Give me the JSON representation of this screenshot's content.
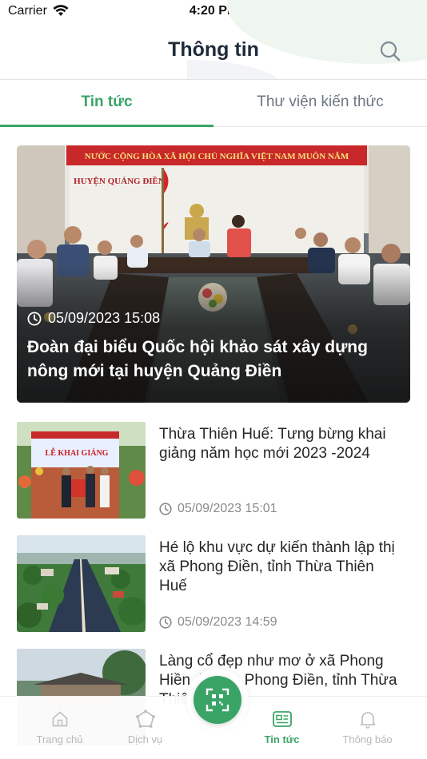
{
  "status_bar": {
    "carrier": "Carrier",
    "time": "4:20 PM"
  },
  "header": {
    "title": "Thông tin",
    "search_icon": "search-icon"
  },
  "tabs": [
    {
      "label": "Tin tức",
      "active": true
    },
    {
      "label": "Thư viện kiến thức",
      "active": false
    }
  ],
  "featured": {
    "date": "05/09/2023 15:08",
    "title": "Đoàn đại biểu Quốc hội khảo sát xây dựng nông mới tại huyện Quảng Điền",
    "banner_text": "NƯỚC CỘNG HÒA XÃ HỘI CHỦ NGHĨA VIỆT NAM MUÔN NĂM",
    "sign_text": "HUYỆN QUẢNG ĐIỀN"
  },
  "articles": [
    {
      "title": "Thừa Thiên Huế: Tưng bừng khai giảng năm học mới 2023 -2024",
      "date": "05/09/2023 15:01",
      "thumb_text": "LỄ KHAI GIẢNG"
    },
    {
      "title": "Hé lộ khu vực dự kiến thành lập thị xã Phong Điền, tỉnh Thừa Thiên Huế",
      "date": "05/09/2023 14:59"
    },
    {
      "title": "Làng cổ đẹp như mơ ở xã Phong Hiền, huyện Phong Điền, tỉnh Thừa Thiên Huế"
    }
  ],
  "bottom_nav": [
    {
      "label": "Trang chủ",
      "icon": "home-icon",
      "active": false
    },
    {
      "label": "Dịch vụ",
      "icon": "services-icon",
      "active": false
    },
    {
      "label": "Tin tức",
      "icon": "news-icon",
      "active": true
    },
    {
      "label": "Thông báo",
      "icon": "bell-icon",
      "active": false
    }
  ],
  "colors": {
    "accent": "#3aa467",
    "title": "#1f2b3a",
    "muted": "#8a8a8a"
  }
}
